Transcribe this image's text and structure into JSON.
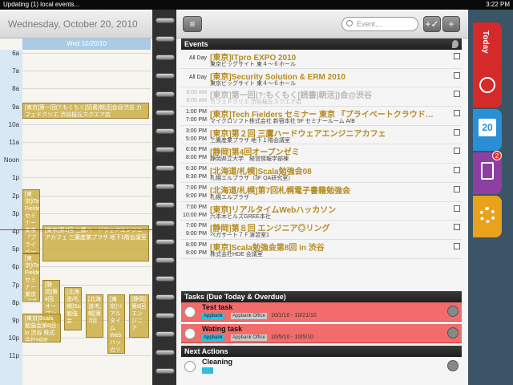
{
  "status": {
    "left": "Updating (1) local events...",
    "right": "3:22 PM"
  },
  "day": {
    "header": "Wednesday, October 20, 2010",
    "day_bar": "Wed 10/20/10",
    "hours": [
      "6a",
      "7a",
      "8a",
      "9a",
      "10a",
      "11a",
      "Noon",
      "1p",
      "2p",
      "3p",
      "4p",
      "5p",
      "6p",
      "7p",
      "8p",
      "9p",
      "10p",
      "11p"
    ],
    "events": [
      {
        "text": "[東京]第一回(?:もくもく[読書|朝活]会@渋谷 カフェドクリエ 渋谷桜丘スクエア店"
      },
      {
        "text": "[東京]iTech Fielders セミナー東京『プライベートクラウド構築』"
      },
      {
        "text": "[東京]第2回 三鷹ハードウェアエンジニアカフェ 三鷹産業プラザ 地下1階会議室"
      },
      {
        "text": "[静岡]第4回オープンゼミ"
      },
      {
        "text": "[北海道/札幌]Scala勉強会"
      },
      {
        "text": "[北海道/札幌]第7回"
      },
      {
        "text": "[東京]リアルタイムWebハッカソン"
      },
      {
        "text": "[静岡]第8回エンジニア"
      },
      {
        "text": "[東京]Scala勉強会第8回 in 渋谷 株式会社HDE"
      }
    ]
  },
  "toolbar": {
    "search_placeholder": "Event,...",
    "menu_label": "≡",
    "done_label": "+✓",
    "add_label": "+"
  },
  "events_header": "Events",
  "events": [
    {
      "time": "All Day",
      "time2": "",
      "title": "[東京]ITpro EXPO 2010",
      "sub": "東京ビッグサイト 東４〜６ホール",
      "past": false
    },
    {
      "time": "All Day",
      "time2": "",
      "title": "[東京]Security Solution & ERM 2010",
      "sub": "東京ビッグサイト 東４〜６ホール",
      "past": false
    },
    {
      "time": "8:00 AM",
      "time2": "9:00 AM",
      "title": "[東京]第一回(?:もくもく[読書|朝活])会@渋谷",
      "sub": "カフェドクリエ 渋谷桜丘スクエア店",
      "past": true
    },
    {
      "time": "1:00 PM",
      "time2": "7:00 PM",
      "title": "[東京]Tech Fielders セミナー 東京 『プライベートクラウド…",
      "sub": "マイクロソフト株式会社 新宿本社 5F セミナールーム A/B",
      "past": false
    },
    {
      "time": "3:00 PM",
      "time2": "5:00 PM",
      "title": "[東京]第２回 三鷹ハードウェアエンジニアカフェ",
      "sub": "三鷹産業プラザ 地下１階会議室",
      "past": false
    },
    {
      "time": "6:00 PM",
      "time2": "8:00 PM",
      "title": "[静岡]第4回オープンゼミ",
      "sub": "静岡県立大学　経営情報学部棟",
      "past": false
    },
    {
      "time": "6:30 PM",
      "time2": "8:30 PM",
      "title": "[北海道/札幌]Scala勉強会08",
      "sub": "札幌エルプラザ（3F OA研究室）",
      "past": false
    },
    {
      "time": "7:00 PM",
      "time2": "9:00 PM",
      "title": "[北海道/札幌]第7回札幌電子書籍勉強会",
      "sub": "札幌エルプラザ",
      "past": false
    },
    {
      "time": "7:00 PM",
      "time2": "10:00 PM",
      "title": "[東京]リアルタイムWebハッカソン",
      "sub": "六本木ヒルズGREE本社",
      "past": false
    },
    {
      "time": "7:00 PM",
      "time2": "9:00 PM",
      "title": "[静岡]第８回 エンジニア◎リング",
      "sub": "ペガサート７Ｆ演習室1",
      "past": false
    },
    {
      "time": "8:00 PM",
      "time2": "9:00 PM",
      "title": "[東京]Scala勉強会第8回 in 渋谷",
      "sub": "株式会社HDE 会議室",
      "past": false
    }
  ],
  "tasks_header": "Tasks (Due Today & Overdue)",
  "tasks": [
    {
      "title": "Test task",
      "tag1": "Appbank",
      "tag2": "Appbank Office",
      "dates": "10/1/10 - 10/21/10"
    },
    {
      "title": "Wating task",
      "tag1": "Appbank",
      "tag2": "Appbank Office",
      "dates": "10/5/10 - 10/5/10"
    }
  ],
  "next_header": "Next Actions",
  "next_actions": [
    {
      "title": "Cleaning"
    }
  ],
  "side_tabs": {
    "today_label": "Today",
    "cal_day": "20",
    "task_badge": "2",
    "colors": {
      "today": "#d42a2a",
      "calendar": "#2b8fd6",
      "tasks": "#8d3fa3",
      "settings": "#e8a21b"
    }
  }
}
